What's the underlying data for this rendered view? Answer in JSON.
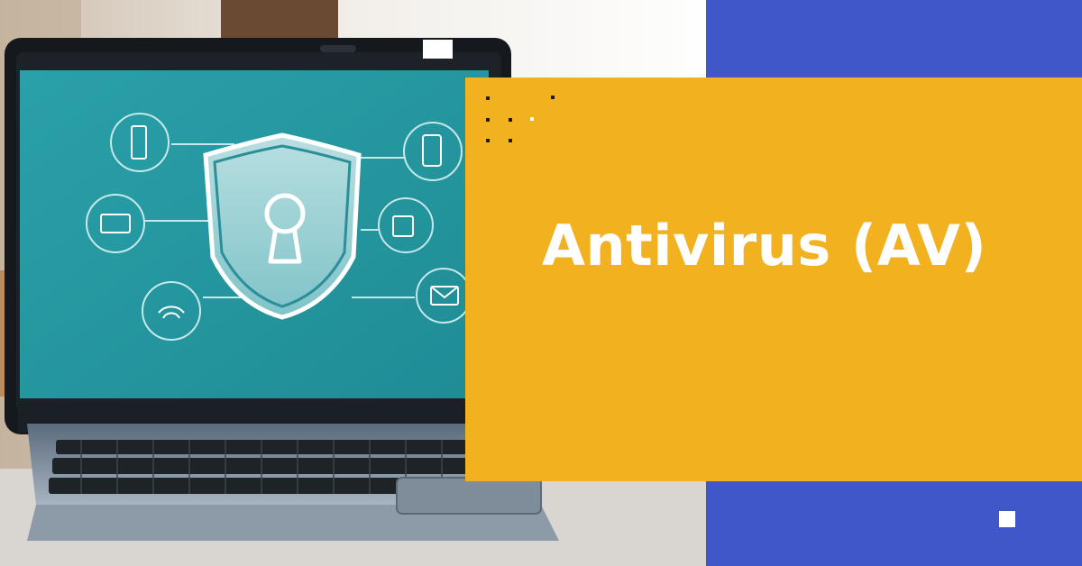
{
  "banner": {
    "title": "Antivirus (AV)"
  },
  "colors": {
    "accent_yellow": "#f2b11f",
    "accent_blue": "#3f57c9",
    "screen_teal": "#2a9aa2",
    "dot_dark": "#1f1a10",
    "dot_light": "#ffffff"
  },
  "illustration": {
    "subject": "laptop-with-security-shield",
    "screen_icons": [
      "server-icon",
      "laptop-icon",
      "wifi-icon",
      "tablet-icon",
      "files-icon",
      "mail-icon",
      "keyhole-shield-icon"
    ]
  }
}
